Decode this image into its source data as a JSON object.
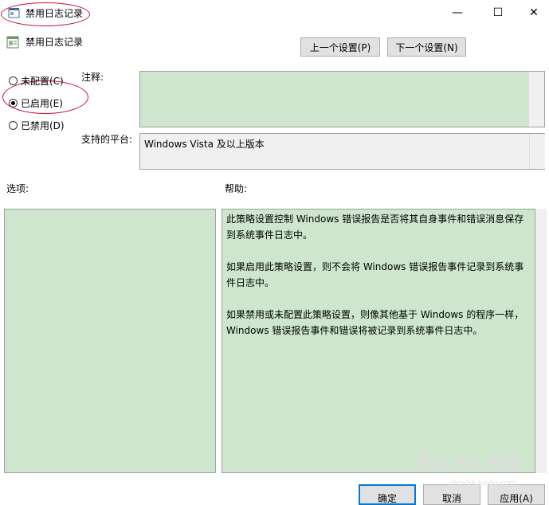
{
  "window": {
    "title": "禁用日志记录",
    "minimize_glyph": "—",
    "maximize_glyph": "☐",
    "close_glyph": "✕"
  },
  "header": {
    "title": "禁用日志记录",
    "prev_setting": "上一个设置(P)",
    "next_setting": "下一个设置(N)"
  },
  "state_options": [
    {
      "label": "未配置(C)",
      "checked": false
    },
    {
      "label": "已启用(E)",
      "checked": true
    },
    {
      "label": "已禁用(D)",
      "checked": false
    }
  ],
  "comment": {
    "label": "注释:",
    "value": ""
  },
  "platform": {
    "label": "支持的平台:",
    "value": "Windows Vista 及以上版本"
  },
  "options": {
    "label": "选项:"
  },
  "help": {
    "label": "帮助:",
    "paragraphs": [
      "此策略设置控制 Windows 错误报告是否将其自身事件和错误消息保存到系统事件日志中。",
      "如果启用此策略设置，则不会将 Windows 错误报告事件记录到系统事件日志中。",
      "如果禁用或未配置此策略设置，则像其他基于 Windows 的程序一样，Windows 错误报告事件和错误将被记录到系统事件日志中。"
    ]
  },
  "footer": {
    "ok": "确定",
    "cancel": "取消",
    "apply": "应用(A)"
  },
  "watermark": {
    "text": "Bai du 经验",
    "sub": "jingyan.baidu.com"
  },
  "colors": {
    "field_green": "#cde6cd",
    "annotation_red": "#c8102e"
  }
}
